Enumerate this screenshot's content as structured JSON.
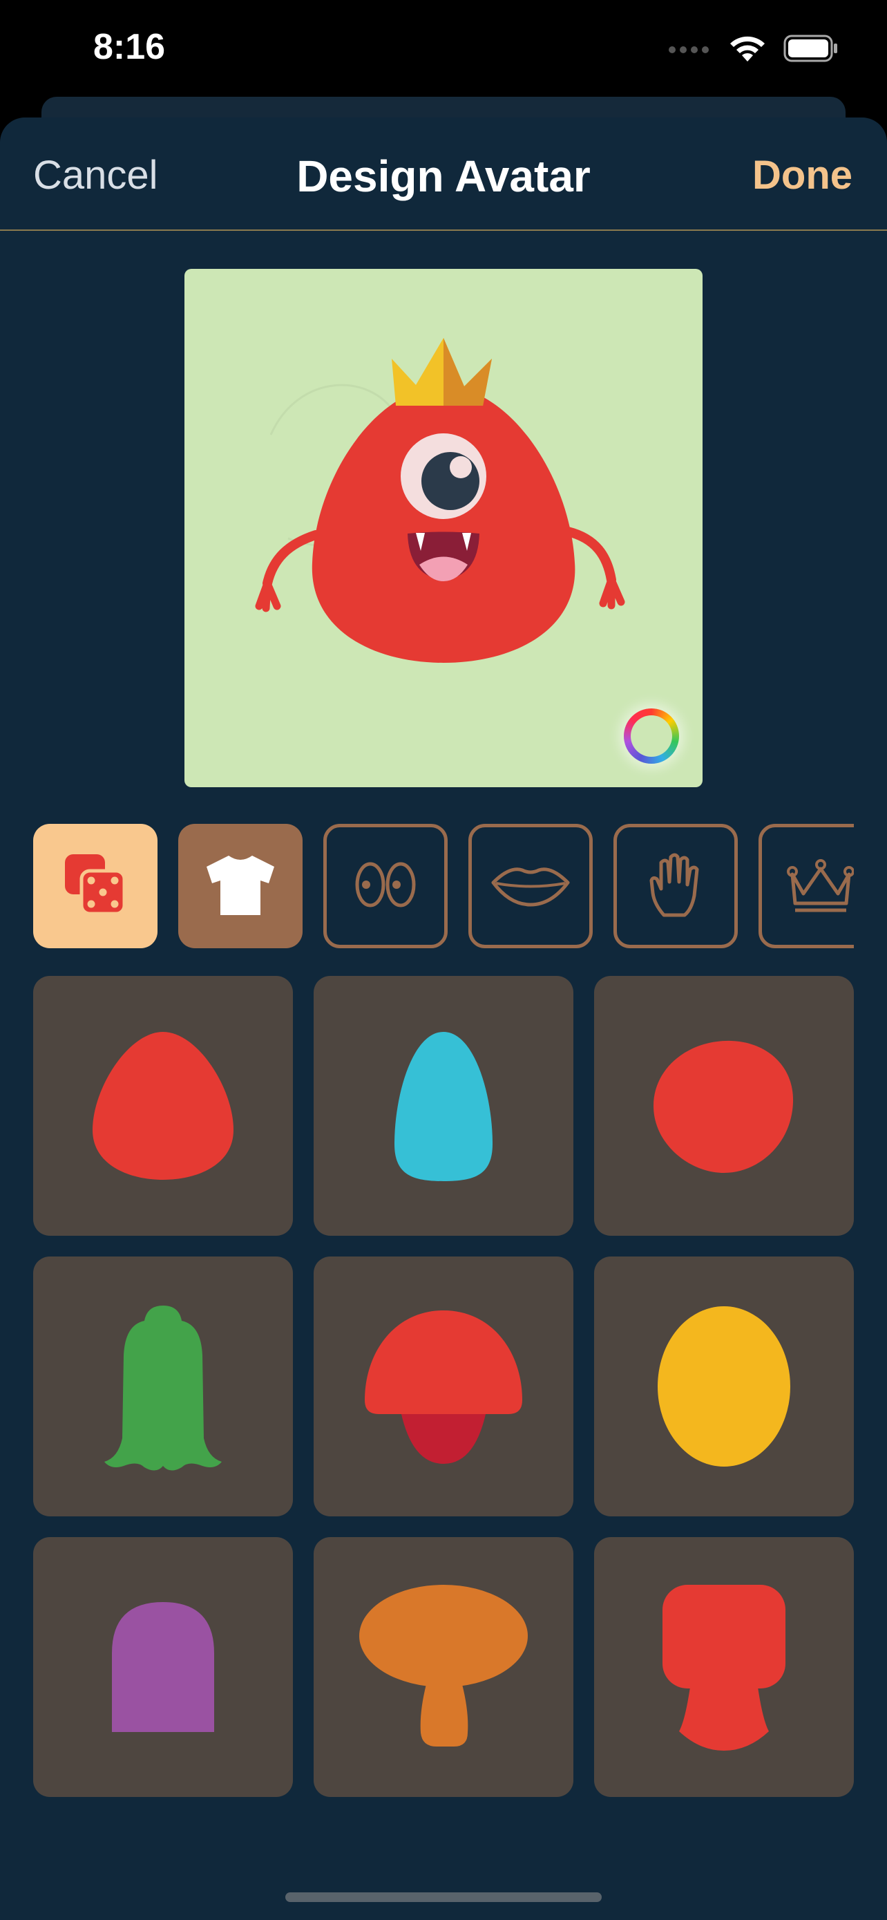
{
  "status_bar": {
    "time": "8:16",
    "icons": [
      "cellular-icon",
      "wifi-icon",
      "battery-icon"
    ]
  },
  "nav": {
    "cancel_label": "Cancel",
    "title": "Design Avatar",
    "done_label": "Done"
  },
  "colors": {
    "sheet_background": "#10283b",
    "accent": "#f4c38b",
    "preview_background": "#cde7b5",
    "tile_background": "#4e4640",
    "category_selected": "#f9c88e",
    "category_active": "#9a6b4d"
  },
  "categories": [
    {
      "name": "randomize",
      "icon": "dice-icon",
      "state": "selected"
    },
    {
      "name": "body",
      "icon": "shirt-icon",
      "state": "active"
    },
    {
      "name": "eyes",
      "icon": "eyes-icon",
      "state": "inactive"
    },
    {
      "name": "mouth",
      "icon": "lips-icon",
      "state": "inactive"
    },
    {
      "name": "arms",
      "icon": "hand-icon",
      "state": "inactive"
    },
    {
      "name": "accessories",
      "icon": "crown-icon",
      "state": "inactive"
    }
  ],
  "body_options": [
    {
      "shape": "egg",
      "color": "#e53a33"
    },
    {
      "shape": "tall-egg",
      "color": "#36c0d6"
    },
    {
      "shape": "round-blob",
      "color": "#e53a33"
    },
    {
      "shape": "ghost",
      "color": "#43a34a"
    },
    {
      "shape": "mushroom-cap",
      "color": "#e53a33"
    },
    {
      "shape": "oval",
      "color": "#f4b71e"
    },
    {
      "shape": "arch",
      "color": "#9a52a2"
    },
    {
      "shape": "mushroom",
      "color": "#d9782a"
    },
    {
      "shape": "block-bell",
      "color": "#e53a33"
    }
  ]
}
